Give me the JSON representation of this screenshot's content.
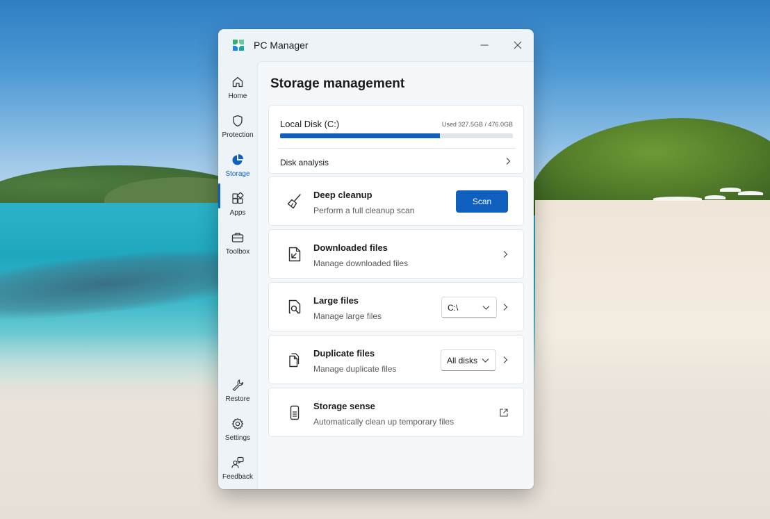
{
  "app": {
    "title": "PC Manager",
    "logo_icon": "pc-manager-logo-icon",
    "minimize_icon": "minimize-icon",
    "close_icon": "close-icon"
  },
  "sidebar": {
    "top_items": [
      {
        "label": "Home",
        "icon": "home-icon"
      },
      {
        "label": "Protection",
        "icon": "shield-icon"
      },
      {
        "label": "Storage",
        "icon": "pie-chart-icon",
        "active": true
      },
      {
        "label": "Apps",
        "icon": "apps-grid-icon"
      },
      {
        "label": "Toolbox",
        "icon": "toolbox-icon"
      }
    ],
    "bottom_items": [
      {
        "label": "Restore",
        "icon": "wrench-icon"
      },
      {
        "label": "Settings",
        "icon": "gear-icon"
      },
      {
        "label": "Feedback",
        "icon": "feedback-icon"
      }
    ]
  },
  "page": {
    "title": "Storage management"
  },
  "disk": {
    "name": "Local Disk (C:)",
    "usage_text": "Used 327.5GB / 476.0GB",
    "used_fraction": 0.688,
    "analysis_label": "Disk analysis"
  },
  "features": {
    "deep_cleanup": {
      "title": "Deep cleanup",
      "subtitle": "Perform a full cleanup scan",
      "button_label": "Scan",
      "icon": "broom-icon"
    },
    "downloaded_files": {
      "title": "Downloaded files",
      "subtitle": "Manage downloaded files",
      "icon": "download-file-icon"
    },
    "large_files": {
      "title": "Large files",
      "subtitle": "Manage large files",
      "select_value": "C:\\",
      "icon": "search-file-icon"
    },
    "duplicate_files": {
      "title": "Duplicate files",
      "subtitle": "Manage duplicate files",
      "select_value": "All disks",
      "icon": "duplicate-file-icon"
    },
    "storage_sense": {
      "title": "Storage sense",
      "subtitle": "Automatically clean up temporary files",
      "icon": "storage-sense-icon",
      "action_icon": "external-link-icon"
    }
  },
  "colors": {
    "accent": "#0f5fbf",
    "window_bg": "#eef3f8",
    "card_bg": "#ffffff",
    "progress_track": "#e1e4e8"
  }
}
